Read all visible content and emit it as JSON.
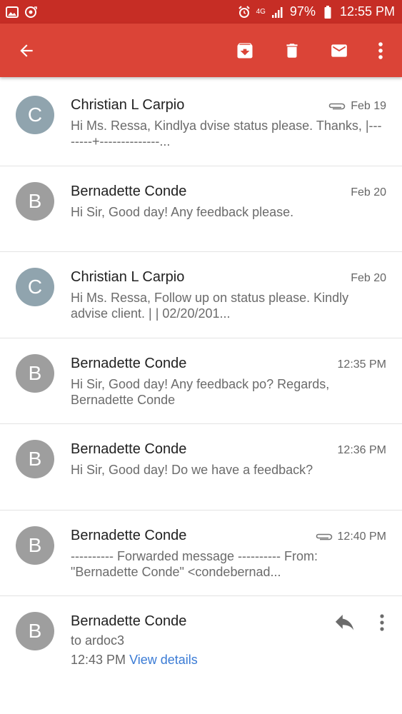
{
  "status_bar": {
    "network_label": "4G",
    "battery": "97%",
    "time": "12:55 PM",
    "icons": [
      "image-icon",
      "sync-icon",
      "alarm-icon",
      "signal-icon",
      "battery-icon"
    ]
  },
  "app_bar": {
    "color": "#db4437",
    "actions": [
      "back-arrow-icon",
      "archive-icon",
      "delete-icon",
      "mark-unread-icon",
      "more-vert-icon"
    ]
  },
  "messages": [
    {
      "sender": "Christian L Carpio",
      "initial": "C",
      "avatar_color": "#90a4ae",
      "date": "Feb 19",
      "attachment": true,
      "snippet": "Hi Ms. Ressa, Kindlya dvise status please. Thanks, |--------+--------------..."
    },
    {
      "sender": "Bernadette Conde",
      "initial": "B",
      "avatar_color": "#9e9e9e",
      "date": "Feb 20",
      "attachment": false,
      "snippet": "Hi Sir, Good day! Any feedback please."
    },
    {
      "sender": "Christian L Carpio",
      "initial": "C",
      "avatar_color": "#90a4ae",
      "date": "Feb 20",
      "attachment": false,
      "snippet": "Hi Ms. Ressa, Follow up on status please. Kindly advise client. | | 02/20/201..."
    },
    {
      "sender": "Bernadette Conde",
      "initial": "B",
      "avatar_color": "#9e9e9e",
      "date": "12:35 PM",
      "attachment": false,
      "snippet": "Hi Sir, Good day! Any feedback po? Regards, Bernadette Conde"
    },
    {
      "sender": "Bernadette Conde",
      "initial": "B",
      "avatar_color": "#9e9e9e",
      "date": "12:36 PM",
      "attachment": false,
      "snippet": "Hi Sir, Good day! Do we have a feedback?"
    },
    {
      "sender": "Bernadette Conde",
      "initial": "B",
      "avatar_color": "#9e9e9e",
      "date": "12:40 PM",
      "attachment": true,
      "snippet": "---------- Forwarded message ---------- From: \"Bernadette Conde\" <condebernad..."
    }
  ],
  "expanded_message": {
    "sender": "Bernadette Conde",
    "initial": "B",
    "avatar_color": "#9e9e9e",
    "to": "to ardoc3",
    "time": "12:43 PM",
    "view_details": "View details",
    "link_color": "#3a7bd5"
  }
}
